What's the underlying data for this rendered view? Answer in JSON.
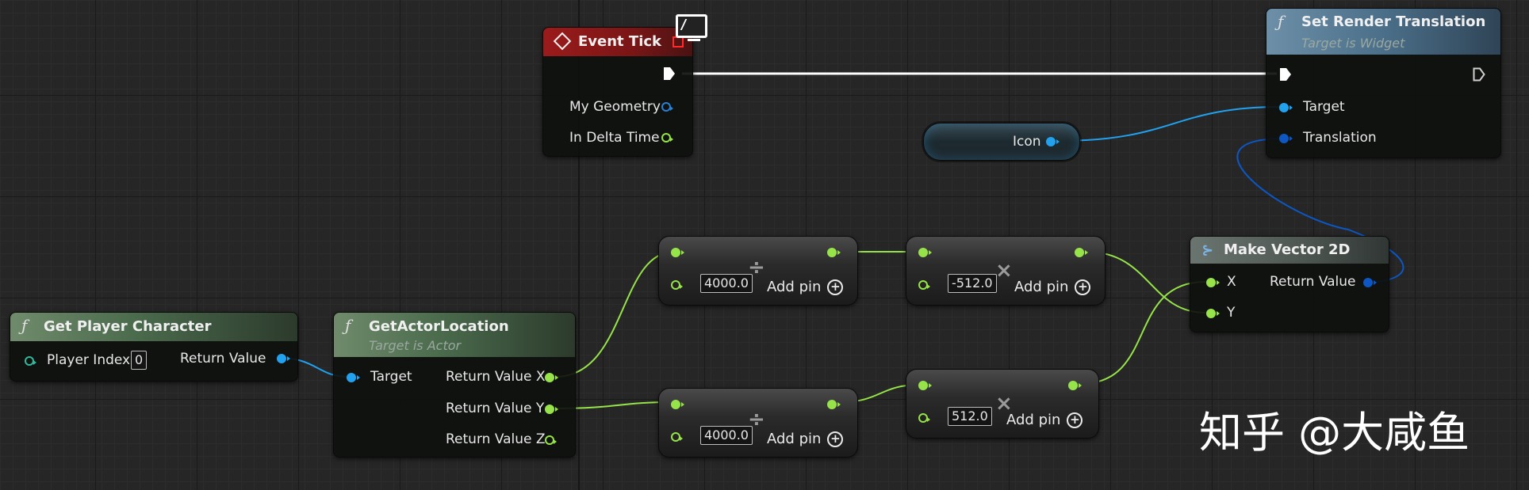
{
  "nodes": {
    "get_player_character": {
      "title": "Get Player Character",
      "icon": "function-icon",
      "pins": {
        "player_index": "Player Index",
        "player_index_value": "0",
        "return_value": "Return Value"
      }
    },
    "get_actor_location": {
      "title": "GetActorLocation",
      "subtitle": "Target is Actor",
      "icon": "function-icon",
      "pins": {
        "target": "Target",
        "return_x": "Return Value X",
        "return_y": "Return Value Y",
        "return_z": "Return Value Z"
      }
    },
    "event_tick": {
      "title": "Event Tick",
      "icon": "event-icon",
      "pins": {
        "my_geometry": "My Geometry",
        "in_delta_time": "In Delta Time"
      }
    },
    "divide_top": {
      "operator": "÷",
      "value": "4000.0",
      "add_pin": "Add pin"
    },
    "multiply_top": {
      "operator": "×",
      "value": "-512.0",
      "add_pin": "Add pin"
    },
    "divide_bottom": {
      "operator": "÷",
      "value": "4000.0",
      "add_pin": "Add pin"
    },
    "multiply_bottom": {
      "operator": "×",
      "value": "512.0",
      "add_pin": "Add pin"
    },
    "icon_var": {
      "label": "Icon"
    },
    "make_vector_2d": {
      "title": "Make Vector 2D",
      "icon": "struct-icon",
      "pins": {
        "x": "X",
        "y": "Y",
        "return_value": "Return Value"
      }
    },
    "set_render_translation": {
      "title": "Set Render Translation",
      "subtitle": "Target is Widget",
      "icon": "function-icon",
      "pins": {
        "target": "Target",
        "translation": "Translation"
      }
    }
  },
  "watermark": "知乎 @大咸鱼",
  "colors": {
    "exec_wire": "#ffffff",
    "float_wire": "#96e34a",
    "object_wire": "#21a1ee",
    "struct_wire": "#0d57c4",
    "event_header": "#9b1b1b",
    "function_header": "#5e7b5c",
    "target_header": "#4b6f89"
  }
}
